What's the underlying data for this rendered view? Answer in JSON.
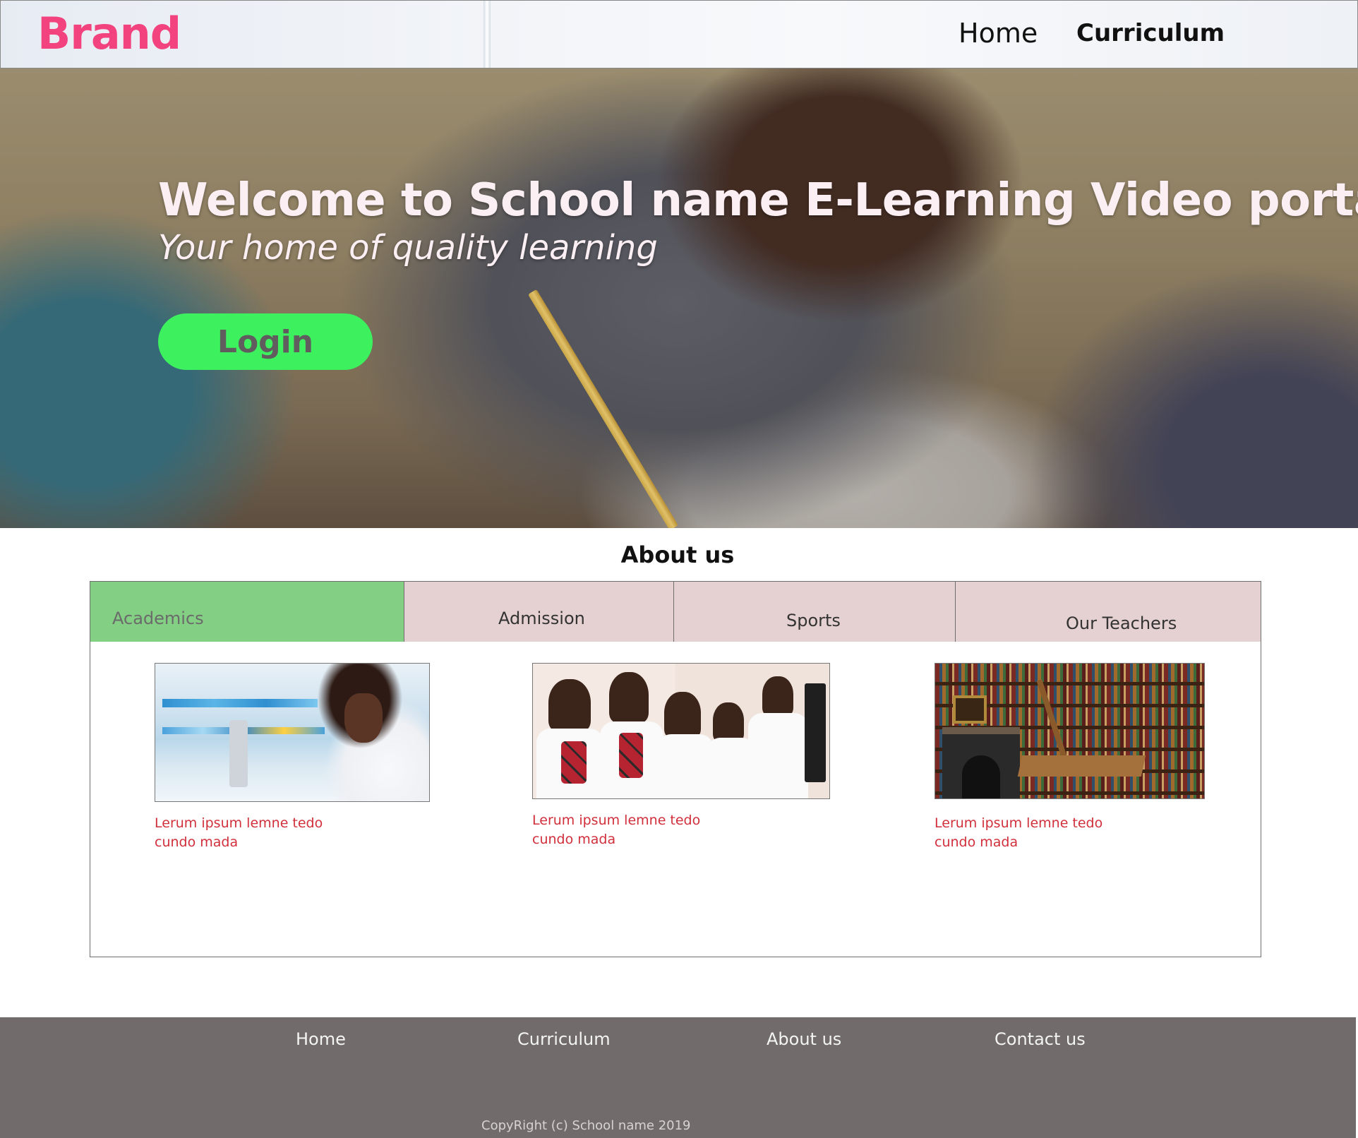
{
  "header": {
    "brand": "Brand",
    "nav": [
      {
        "label": "Home"
      },
      {
        "label": "Curriculum"
      }
    ]
  },
  "hero": {
    "title": "Welcome to School name E-Learning Video portal",
    "subtitle": "Your home of quality learning",
    "login_label": "Login"
  },
  "about": {
    "heading": "About us",
    "tabs": [
      {
        "label": "Academics",
        "active": true
      },
      {
        "label": "Admission",
        "active": false
      },
      {
        "label": "Sports",
        "active": false
      },
      {
        "label": "Our Teachers",
        "active": false
      }
    ],
    "cards": [
      {
        "text": "Lerum ipsum lemne tedo cundo mada"
      },
      {
        "text": "Lerum ipsum lemne tedo cundo mada"
      },
      {
        "text": "Lerum ipsum lemne tedo cundo mada"
      }
    ]
  },
  "footer": {
    "links": [
      {
        "label": "Home"
      },
      {
        "label": "Curriculum"
      },
      {
        "label": "About us"
      },
      {
        "label": "Contact us"
      }
    ],
    "copyright": "CopyRight (c) School name 2019"
  },
  "colors": {
    "brand": "#f2437e",
    "login_button": "#3cf05e",
    "active_tab": "#83cf83",
    "inactive_tab": "#e6d1d2",
    "card_text": "#d12f3b",
    "footer_bg": "#716b6b"
  }
}
